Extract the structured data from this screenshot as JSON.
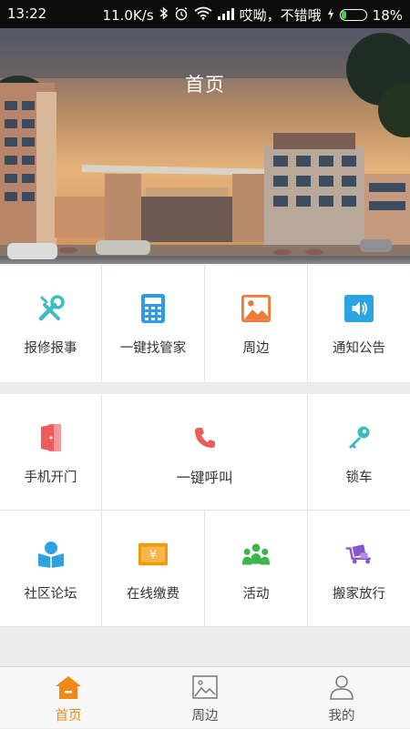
{
  "status_bar": {
    "time": "13:22",
    "speed": "11.0K/s",
    "carrier": "哎呦，不错哦",
    "battery": "18%",
    "battery_level": 0.18,
    "icons": [
      "bluetooth-icon",
      "alarm-icon",
      "wifi-icon",
      "signal-icon",
      "charging-icon",
      "battery-icon"
    ]
  },
  "header": {
    "title": "首页"
  },
  "menu": {
    "row1": [
      {
        "label": "报修报事",
        "icon": "wrench-screwdriver-icon",
        "color": "#3cbcc2"
      },
      {
        "label": "一键找管家",
        "icon": "calculator-icon",
        "color": "#2e9be8"
      },
      {
        "label": "周边",
        "icon": "landscape-icon",
        "color": "#f07a3a"
      },
      {
        "label": "通知公告",
        "icon": "speaker-icon",
        "color": "#2aa3e0"
      }
    ],
    "row2": [
      {
        "label": "手机开门",
        "icon": "door-icon",
        "color": "#ef5a5a"
      },
      {
        "label": "一键呼叫",
        "icon": "phone-icon",
        "color": "#ef5a5a"
      },
      {
        "label": "锁车",
        "icon": "key-icon",
        "color": "#3cbcc2"
      }
    ],
    "row3": [
      {
        "label": "社区论坛",
        "icon": "reader-icon",
        "color": "#2aa3e0"
      },
      {
        "label": "在线缴费",
        "icon": "yuan-bill-icon",
        "color": "#f09a10"
      },
      {
        "label": "活动",
        "icon": "group-icon",
        "color": "#3cb64a"
      },
      {
        "label": "搬家放行",
        "icon": "moving-cart-icon",
        "color": "#8a55c8"
      }
    ]
  },
  "tabbar": {
    "items": [
      {
        "label": "首页",
        "icon": "home-icon",
        "active": true
      },
      {
        "label": "周边",
        "icon": "picture-icon",
        "active": false
      },
      {
        "label": "我的",
        "icon": "person-icon",
        "active": false
      }
    ],
    "accent": "#f08a16"
  }
}
